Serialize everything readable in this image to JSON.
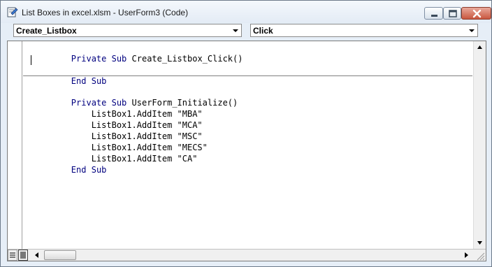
{
  "window": {
    "title": "List Boxes in excel.xlsm - UserForm3 (Code)"
  },
  "object_dropdown": {
    "selected": "Create_Listbox"
  },
  "procedure_dropdown": {
    "selected": "Click"
  },
  "code": {
    "lines": [
      {
        "keyword1": "Private",
        "keyword2": "Sub",
        "text": "Create_Listbox_Click()"
      },
      {
        "keyword": "End",
        "keyword2": "Sub"
      },
      {
        "keyword1": "Private",
        "keyword2": "Sub",
        "text": "UserForm_Initialize()"
      },
      {
        "text": "    ListBox1.AddItem \"MBA\""
      },
      {
        "text": "    ListBox1.AddItem \"MCA\""
      },
      {
        "text": "    ListBox1.AddItem \"MSC\""
      },
      {
        "text": "    ListBox1.AddItem \"MECS\""
      },
      {
        "text": "    ListBox1.AddItem \"CA\""
      },
      {
        "keyword": "End",
        "keyword2": "Sub"
      }
    ]
  },
  "icons": {
    "app": "vba-code-window-icon",
    "minimize": "minimize-icon",
    "maximize": "maximize-icon",
    "close": "close-icon",
    "dropdown": "chevron-down-icon",
    "scroll_up": "arrow-up-icon",
    "scroll_down": "arrow-down-icon",
    "scroll_left": "arrow-left-icon",
    "scroll_right": "arrow-right-icon"
  },
  "colors": {
    "keyword": "#00007f",
    "close_button": "#c9573f"
  }
}
